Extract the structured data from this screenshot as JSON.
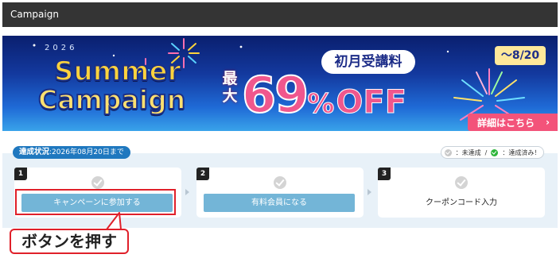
{
  "header": {
    "title": "Campaign"
  },
  "banner": {
    "year": "2026",
    "title_line1": "Summer",
    "title_line2": "Campaign",
    "max_label": "最大",
    "discount_number": "69",
    "discount_percent": "%",
    "discount_off": "OFF",
    "first_month_label": "初月受講料",
    "deadline": "～8/20",
    "details_button": "詳細はこちら",
    "details_chevron": "›"
  },
  "status": {
    "label": "達成状況",
    "deadline_text": ":2026年08月20日まで"
  },
  "legend": {
    "not_achieved": "：未達成",
    "separator": "/",
    "achieved": "：達成済み！"
  },
  "steps": [
    {
      "number": "1",
      "label": "キャンペーンに参加する",
      "kind": "button",
      "achieved": false
    },
    {
      "number": "2",
      "label": "有料会員になる",
      "kind": "button",
      "achieved": false
    },
    {
      "number": "3",
      "label": "クーポンコード入力",
      "kind": "text",
      "achieved": false
    }
  ],
  "annotation": {
    "text": "ボタンを押す"
  },
  "colors": {
    "accent_pink": "#f0578d",
    "button_blue": "#73b5d7",
    "badge_blue": "#1f78bf",
    "highlight_red": "#e0202a"
  }
}
